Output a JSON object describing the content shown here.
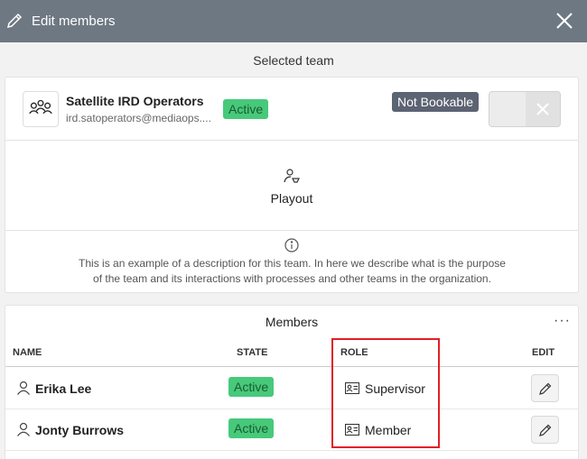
{
  "dialog": {
    "title": "Edit members",
    "selected_team_caption": "Selected team"
  },
  "team": {
    "name": "Satellite IRD Operators",
    "email": "ird.satoperators@mediaops....",
    "state": "Active",
    "bookable_label": "Not Bookable",
    "department": "Playout",
    "description": "This is an example of a description for this team. In here we describe what is the purpose of the team and its interactions with processes and other teams in the organization."
  },
  "members": {
    "title": "Members",
    "more_label": "···",
    "columns": {
      "name": "NAME",
      "state": "STATE",
      "role": "ROLE",
      "edit": "EDIT"
    },
    "rows": [
      {
        "name": "Erika Lee",
        "state": "Active",
        "role": "Supervisor"
      },
      {
        "name": "Jonty Burrows",
        "state": "Active",
        "role": "Member"
      }
    ]
  },
  "colors": {
    "titlebar": "#6e7882",
    "active_badge": "#47c97a",
    "not_bookable_badge": "#5c6372",
    "highlight": "#e01f25"
  },
  "icons": {
    "title": "pencil-icon",
    "close": "close-icon",
    "team": "team-group-icon",
    "department": "department-user-icon",
    "description": "info-icon",
    "member": "user-icon",
    "role": "id-card-icon",
    "edit": "pencil-icon"
  }
}
